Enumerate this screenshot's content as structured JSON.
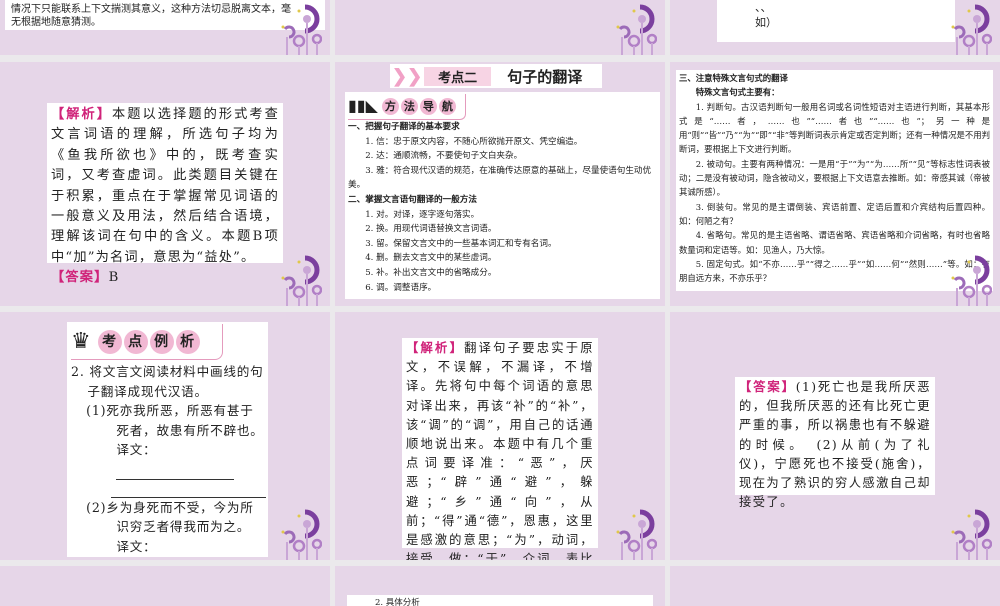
{
  "slides": {
    "s1": {
      "lines": [
        "情况下只能联系上下文揣测其意义，这种方法切忌脱离文本，毫",
        "无根据地随意猜测。"
      ]
    },
    "s3": {
      "lines": [
        "、、",
        "如）"
      ]
    },
    "s4": {
      "tag_analysis": "【解析】",
      "analysis": "本题以选择题的形式考查文言词语的理解，所选句子均为《鱼我所欲也》中的，既考查实词，又考查虚词。此类题目关键在于积累，重点在于掌握常见词语的一般意义及用法，然后结合语境，理解该词在句中的含义。本题B项中“加”为名词，意思为“益处”。",
      "tag_answer": "【答案】",
      "answer": "B"
    },
    "s5": {
      "section_label": "考点二",
      "section_title": "句子的翻译",
      "method_chars": [
        "方",
        "法",
        "导",
        "航"
      ],
      "h1": "一、把握句子翻译的基本要求",
      "req": [
        "1. 信：忠于原文内容，不随心所欲抛开原文、凭空编造。",
        "2. 达：通顺流畅，不要使句子文白夹杂。",
        "3. 雅：符合现代汉语的规范，在准确传达原意的基础上，尽量使语句生动优美。"
      ],
      "h2": "二、掌握文言语句翻译的一般方法",
      "methods": [
        "1. 对。对译，逐字逐句落实。",
        "2. 换。用现代词语替换文言词语。",
        "3. 留。保留文言文中的一些基本词汇和专有名词。",
        "4. 删。删去文言文中的某些虚词。",
        "5. 补。补出文言文中的省略成分。",
        "6. 调。调整语序。"
      ]
    },
    "s6": {
      "h3": "三、注意特殊文言句式的翻译",
      "sub": "特殊文言句式主要有：",
      "items": [
        "1. 判断句。古汉语判断句一般用名词或名词性短语对主语进行判断，其基本形式是“……者，……也”“……者也”“……也”；另一种是用“则”“皆”“乃”“为”“即”“非”等判断词表示肯定或否定判断；还有一种情况是不用判断词，要根据上下文进行判断。",
        "2. 被动句。主要有两种情况：一是用“于”“为”“为……所”“见”等标志性词表被动；二是没有被动词，隐含被动义，要根据上下文语意去推断。如：帝感其诚（帝被其诚所感）。",
        "3. 倒装句。常见的是主谓倒装、宾语前置、定语后置和介宾结构后置四种。如：何陋之有？",
        "4. 省略句。常见的是主语省略、谓语省略、宾语省略和介词省略，有时也省略数量词和定语等。如：见渔人，乃大惊。",
        "5. 固定句式。如“不亦……乎”“得之……乎”“如……何”“然则……”等。如：有朋自远方来，不亦乐乎？"
      ]
    },
    "s7": {
      "example_chars": [
        "考",
        "点",
        "例",
        "析"
      ],
      "q": "2. 将文言文阅读材料中画线的句子翻译成现代汉语。",
      "q1": "(1)死亦我所恶，所恶有甚于死者，故患有所不辟也。",
      "q2": "(2)乡为身死而不受，今为所识穷乏者得我而为之。",
      "translation_label": "译文："
    },
    "s8": {
      "tag_analysis": "【解析】",
      "analysis": "翻译句子要忠实于原文，不误解，不漏译，不增译。先将句中每个词语的意思对译出来，再该“补”的“补”，该“调”的“调”，用自己的话通顺地说出来。本题中有几个重点词要译准：“恶”，厌恶；“辟”通“避”，躲避；“乡”通“向”，从前；“得”通“德”，恩惠，这里是感激的意思；“为”，动词，接受，做；“于”，介词，表比较，可译为“比”。"
    },
    "s9": {
      "tag_answer": "【答案】",
      "answer": "(1)死亡也是我所厌恶的，但我所厌恶的还有比死亡更严重的事，所以祸患也有不躲避的时候。　(2)从前(为了礼仪)，宁愿死也不接受(施舍)，现在为了熟识的穷人感激自己却接受了。"
    },
    "s11": {
      "line": "2. 具体分析"
    }
  },
  "colors": {
    "slide_bg": "#e6d6e8",
    "accent": "#d0237a",
    "deco": "#7b3f9e"
  }
}
